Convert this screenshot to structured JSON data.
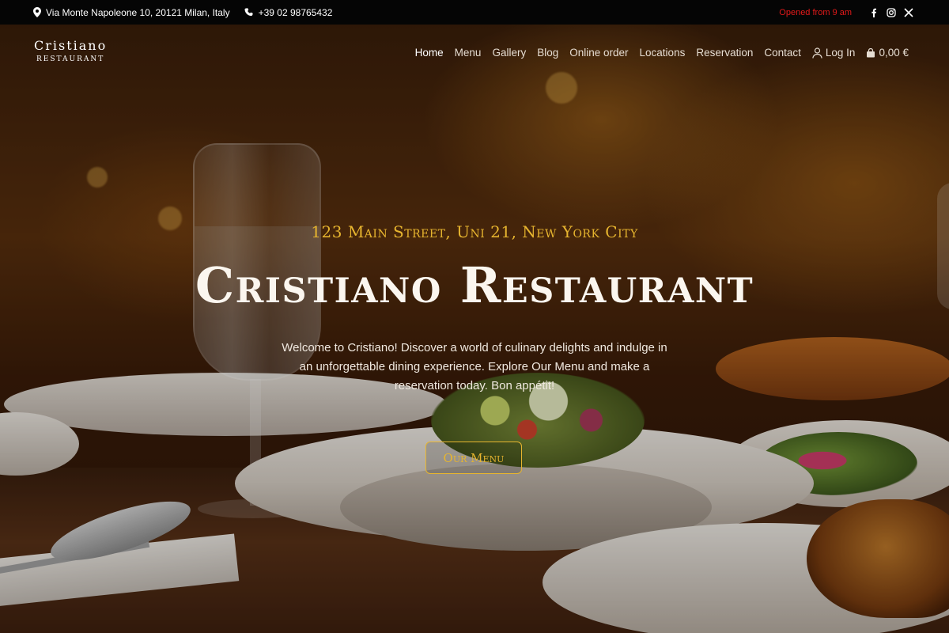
{
  "topbar": {
    "address": "Via Monte Napoleone 10, 20121 Milan, Italy",
    "phone": "+39 02 98765432",
    "opened": "Opened from 9 am",
    "social": [
      "facebook-icon",
      "instagram-icon",
      "x-icon"
    ]
  },
  "logo": {
    "name": "Cristiano",
    "subtitle": "Restaurant"
  },
  "nav": {
    "items": [
      "Home",
      "Menu",
      "Gallery",
      "Blog",
      "Online order",
      "Locations",
      "Reservation",
      "Contact"
    ],
    "active": "Home",
    "login": "Log In",
    "cart": "0,00 €"
  },
  "hero": {
    "address": "123 Main Street, Uni 21, New York City",
    "title": "Cristiano Restaurant",
    "description": "Welcome to Cristiano! Discover a world of culinary delights and indulge in an unforgettable dining experience. Explore Our Menu and make a reservation today. Bon appétit!",
    "cta": "Our Menu"
  },
  "colors": {
    "accent": "#e7b52f",
    "opened": "#e21a1a",
    "topbar_bg": "#050505"
  }
}
